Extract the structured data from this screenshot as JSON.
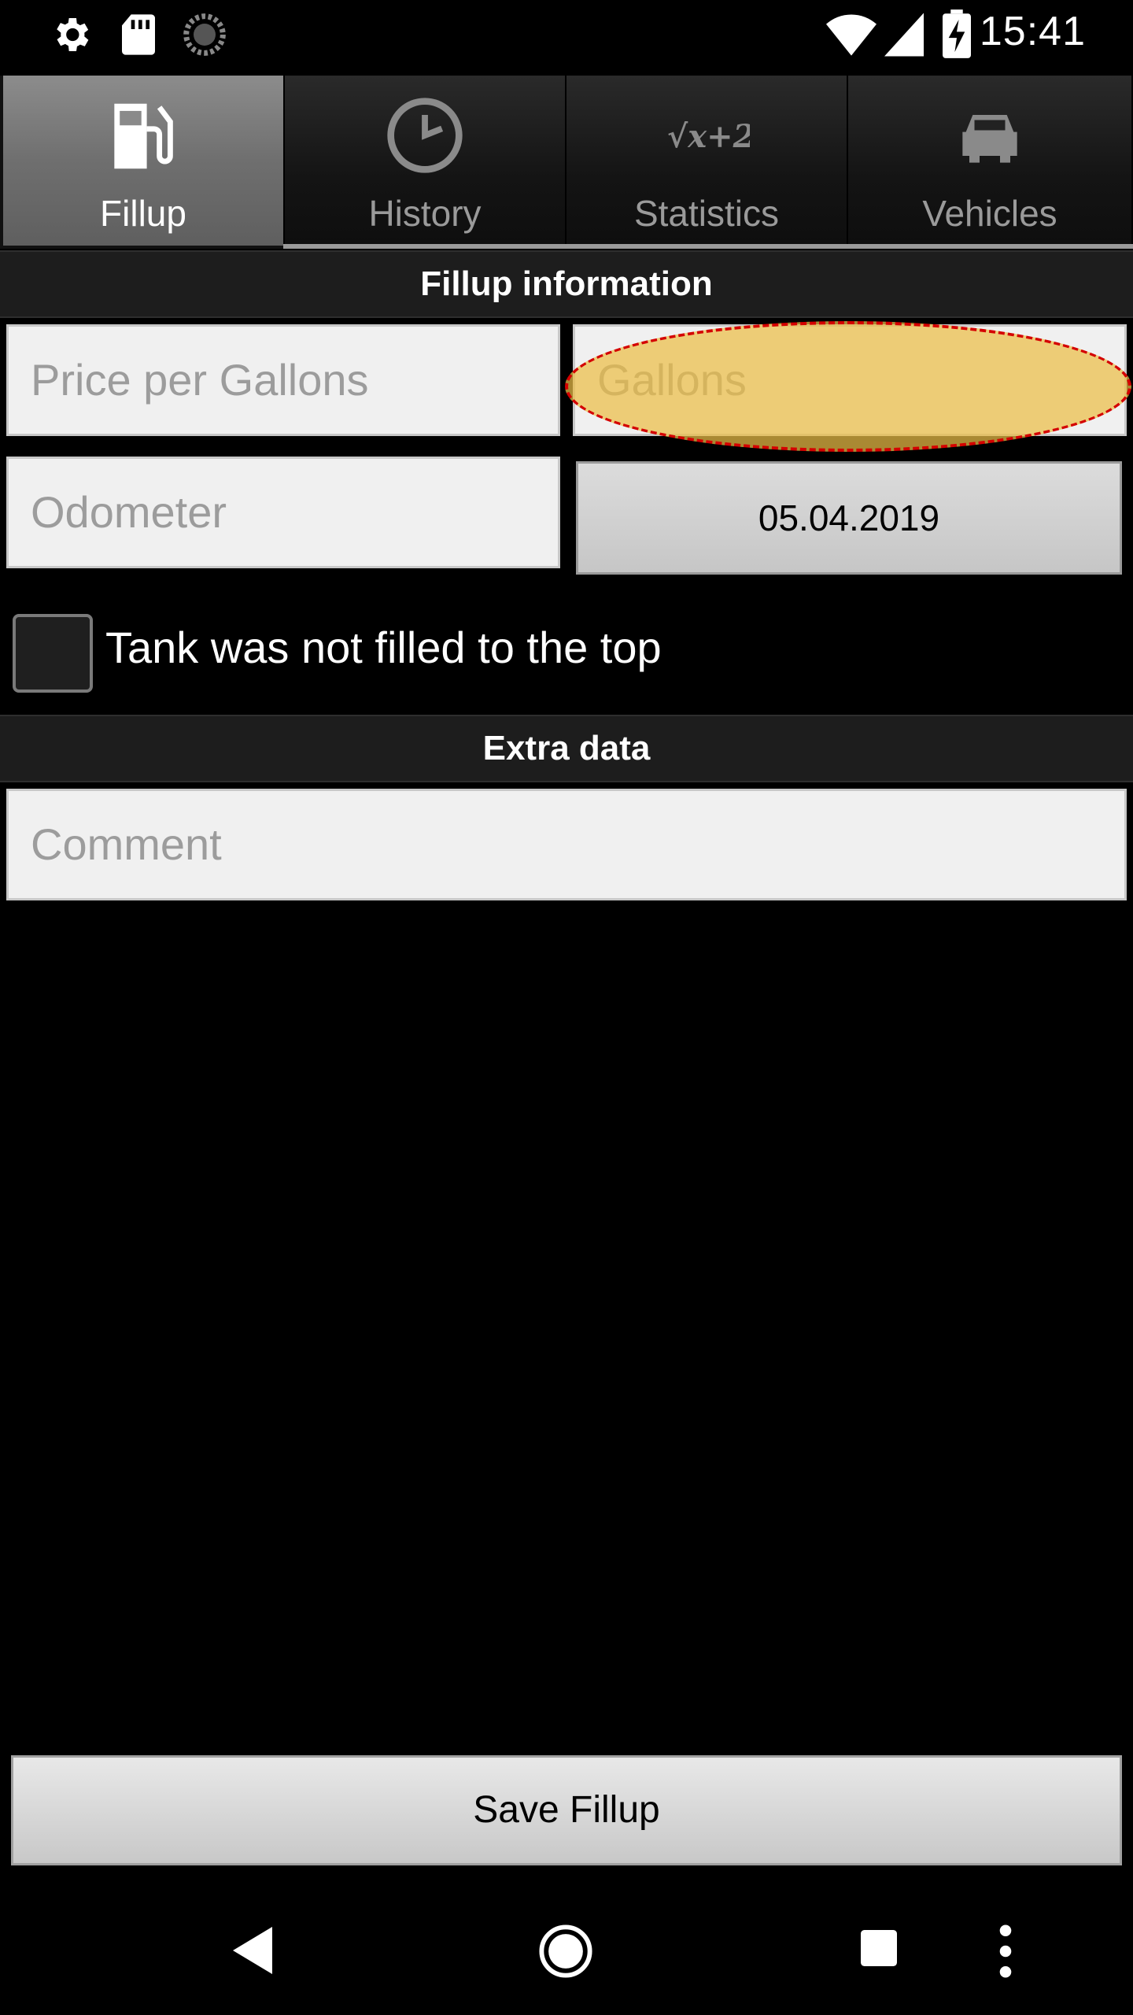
{
  "status_bar": {
    "time": "15:41",
    "icons": [
      "settings-icon",
      "sd-card-icon",
      "sync-icon",
      "wifi-icon",
      "signal-icon",
      "battery-charging-icon"
    ]
  },
  "tabs": [
    {
      "label": "Fillup",
      "icon": "fuel-pump-icon",
      "active": true
    },
    {
      "label": "History",
      "icon": "clock-icon",
      "active": false
    },
    {
      "label": "Statistics",
      "icon": "formula-icon",
      "active": false
    },
    {
      "label": "Vehicles",
      "icon": "car-icon",
      "active": false
    }
  ],
  "fillup_section": {
    "title": "Fillup information",
    "price_placeholder": "Price per Gallons",
    "gallons_placeholder": "Gallons",
    "odometer_placeholder": "Odometer",
    "date_value": "05.04.2019",
    "checkbox_label": "Tank was not filled to the top",
    "checkbox_checked": false
  },
  "extra_section": {
    "title": "Extra data",
    "comment_placeholder": "Comment"
  },
  "save_button_label": "Save Fillup",
  "highlight_color": "#F0C860",
  "nav_icons": [
    "back-icon",
    "home-icon",
    "recents-icon",
    "overflow-menu-icon"
  ]
}
